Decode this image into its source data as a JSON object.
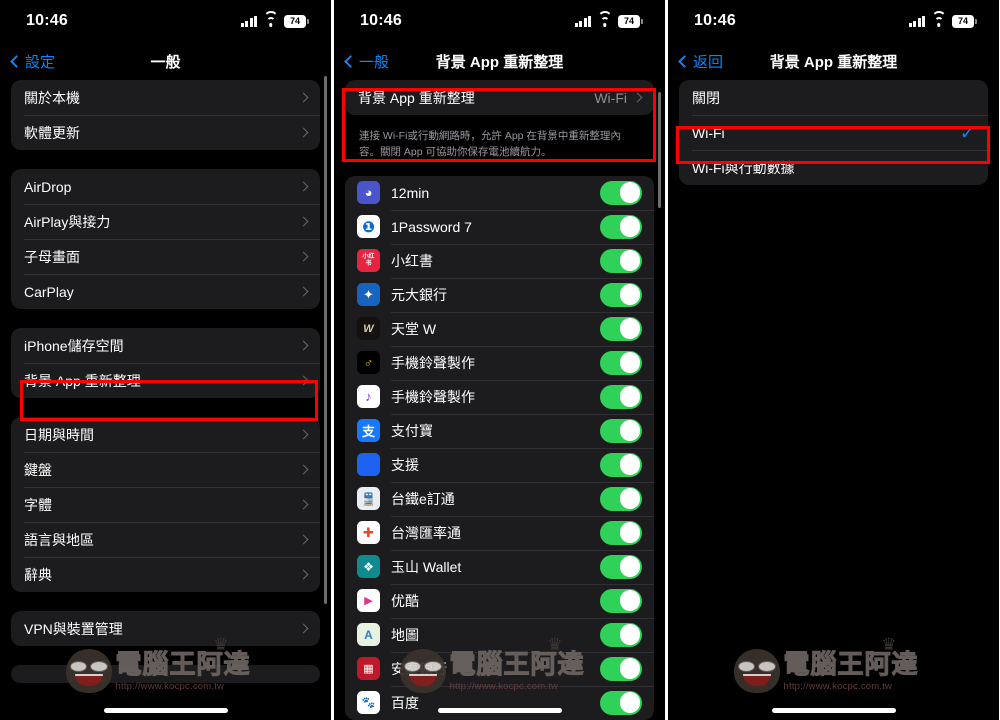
{
  "statusbar": {
    "time": "10:46",
    "battery": "74",
    "signal_icon": "cellular-signal-icon",
    "wifi_icon": "wifi-icon",
    "battery_icon": "battery-icon"
  },
  "colors": {
    "accent": "#0a84ff",
    "toggle_on": "#30d158",
    "highlight": "#ff0000",
    "row_bg": "#1c1c1e",
    "page_bg": "#000000"
  },
  "watermark": {
    "title": "電腦王阿達",
    "url": "http://www.kocpc.com.tw"
  },
  "panel1": {
    "nav": {
      "back": "設定",
      "title": "一般"
    },
    "groups": [
      {
        "rows": [
          {
            "label": "關於本機"
          },
          {
            "label": "軟體更新"
          }
        ]
      },
      {
        "rows": [
          {
            "label": "AirDrop"
          },
          {
            "label": "AirPlay與接力"
          },
          {
            "label": "子母畫面"
          },
          {
            "label": "CarPlay"
          }
        ]
      },
      {
        "rows": [
          {
            "label": "iPhone儲存空間"
          },
          {
            "label": "背景 App 重新整理"
          }
        ]
      },
      {
        "rows": [
          {
            "label": "日期與時間"
          },
          {
            "label": "鍵盤"
          },
          {
            "label": "字體"
          },
          {
            "label": "語言與地區"
          },
          {
            "label": "辭典"
          }
        ]
      },
      {
        "rows": [
          {
            "label": "VPN與裝置管理"
          }
        ]
      }
    ]
  },
  "panel2": {
    "nav": {
      "back": "一般",
      "title": "背景 App 重新整理"
    },
    "setting": {
      "label": "背景 App 重新整理",
      "value": "Wi-Fi"
    },
    "note": "連接 Wi-Fi或行動網路時，允許 App 在背景中重新整理內容。關閉 App 可協助你保存電池續航力。",
    "apps": [
      {
        "name": "12min",
        "on": true,
        "icon": "app-icon-12min",
        "glyph": "◕",
        "bg": "#4a55c9",
        "fg": "#ffffff"
      },
      {
        "name": "1Password 7",
        "on": true,
        "icon": "app-icon-1password",
        "glyph": "❶",
        "bg": "#ffffff",
        "fg": "#0a6bd4"
      },
      {
        "name": "小红書",
        "on": true,
        "icon": "app-icon-xiaohongshu",
        "glyph": "小红书",
        "bg": "#e8233f",
        "fg": "#ffffff"
      },
      {
        "name": "元大銀行",
        "on": true,
        "icon": "app-icon-yuanta-bank",
        "glyph": "✦",
        "bg": "#1565c0",
        "fg": "#ffffff"
      },
      {
        "name": "天堂 W",
        "on": true,
        "icon": "app-icon-lineage-w",
        "glyph": "W",
        "bg": "#14110f",
        "fg": "#cfc6b0"
      },
      {
        "name": "手機鈴聲製作",
        "on": true,
        "icon": "app-icon-ringtone-maker-1",
        "glyph": "♂",
        "bg": "#000000",
        "fg": "#f5c518"
      },
      {
        "name": "手機鈴聲製作",
        "on": true,
        "icon": "app-icon-ringtone-maker-2",
        "glyph": "♪",
        "bg": "#ffffff",
        "fg": "#8a2be2"
      },
      {
        "name": "支付寶",
        "on": true,
        "icon": "app-icon-alipay",
        "glyph": "支",
        "bg": "#1677ff",
        "fg": "#ffffff"
      },
      {
        "name": "支援",
        "on": true,
        "icon": "app-icon-apple-support",
        "glyph": "",
        "bg": "#1d62f0",
        "fg": "#ffffff"
      },
      {
        "name": "台鐵e訂通",
        "on": true,
        "icon": "app-icon-tra-booking",
        "glyph": "🚆",
        "bg": "#eef1f5",
        "fg": "#2b4a7a"
      },
      {
        "name": "台灣匯率通",
        "on": true,
        "icon": "app-icon-tw-exchange-rate",
        "glyph": "✚",
        "bg": "#ffffff",
        "fg": "#e04a2f"
      },
      {
        "name": "玉山 Wallet",
        "on": true,
        "icon": "app-icon-esun-wallet",
        "glyph": "❖",
        "bg": "#0f8a8f",
        "fg": "#ffffff"
      },
      {
        "name": "优酷",
        "on": true,
        "icon": "app-icon-youku",
        "glyph": "▶",
        "bg": "#ffffff",
        "fg": "#e0328c"
      },
      {
        "name": "地圖",
        "on": true,
        "icon": "app-icon-maps",
        "glyph": "A",
        "bg": "#eaf4e4",
        "fg": "#2f7bd6"
      },
      {
        "name": "安泰銀行",
        "on": true,
        "icon": "app-icon-entie-bank",
        "glyph": "▦",
        "bg": "#c0172a",
        "fg": "#ffffff"
      },
      {
        "name": "百度",
        "on": true,
        "icon": "app-icon-baidu",
        "glyph": "🐾",
        "bg": "#ffffff",
        "fg": "#2b4fd4"
      }
    ]
  },
  "panel3": {
    "nav": {
      "back": "返回",
      "title": "背景 App 重新整理"
    },
    "options": [
      {
        "label": "關閉",
        "selected": false
      },
      {
        "label": "Wi-Fi",
        "selected": true
      },
      {
        "label": "Wi-Fi與行動數據",
        "selected": false
      }
    ]
  }
}
